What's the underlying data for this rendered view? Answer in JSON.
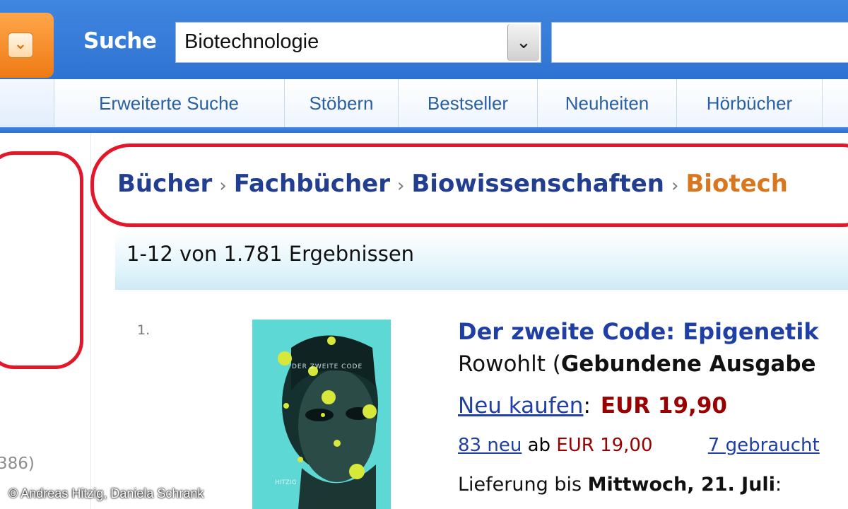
{
  "header": {
    "menu_icon": "chevron-down-icon",
    "search_label": "Suche",
    "category_value": "Biotechnologie",
    "query_value": ""
  },
  "nav": {
    "items": [
      "Erweiterte Suche",
      "Stöbern",
      "Bestseller",
      "Neuheiten",
      "Hörbücher"
    ]
  },
  "breadcrumb": {
    "items": [
      "Bücher",
      "Fachbücher",
      "Biowissenschaften"
    ],
    "current": "Biotech"
  },
  "results": {
    "count_text": "1-12 von 1.781 Ergebnissen"
  },
  "left_column": {
    "count_text": "386)"
  },
  "product": {
    "rank": "1.",
    "title": "Der zweite Code: Epigenetik",
    "publisher": "Rowohlt",
    "binding": "Gebundene Ausgabe",
    "buy_label": "Neu kaufen",
    "price": "EUR 19,90",
    "new_offers": "83 neu",
    "offers_from": "ab",
    "offers_price": "EUR 19,00",
    "used_offers": "7 gebraucht",
    "delivery_prefix": "Lieferung bis",
    "delivery_date": "Mittwoch, 21. Juli",
    "cover_title": "DER ZWEITE CODE",
    "cover_author": "HITZIG"
  },
  "credit": "© Andreas Hitzig, Daniela Schrank",
  "colors": {
    "header_blue": "#2f73d2",
    "menu_orange": "#ee7a14",
    "link_blue": "#1f3fa5",
    "price_red": "#990000",
    "highlight_red": "#e4162a",
    "breadcrumb_current": "#d8771d"
  }
}
